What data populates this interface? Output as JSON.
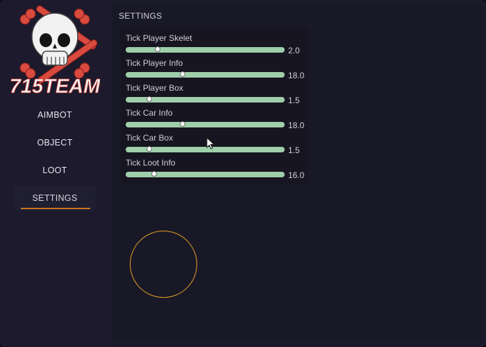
{
  "app": {
    "logo_text": "715TEAM",
    "accent_color": "#c8781e",
    "fov_circle_color": "#e3a227",
    "slider_color": "#9fceaa"
  },
  "sidebar": {
    "items": [
      {
        "label": "AIMBOT",
        "active": false
      },
      {
        "label": "OBJECT",
        "active": false
      },
      {
        "label": "LOOT",
        "active": false
      },
      {
        "label": "SETTINGS",
        "active": true
      }
    ]
  },
  "settings": {
    "title": "SETTINGS",
    "sliders": [
      {
        "label": "Tick Player Skelet",
        "value": "2.0",
        "level": 0.2
      },
      {
        "label": "Tick Player Info",
        "value": "18.0",
        "level": 0.36
      },
      {
        "label": "Tick Player Box",
        "value": "1.5",
        "level": 0.15
      },
      {
        "label": "Tick Car Info",
        "value": "18.0",
        "level": 0.36
      },
      {
        "label": "Tick Car Box",
        "value": "1.5",
        "level": 0.15
      },
      {
        "label": "Tick Loot Info",
        "value": "16.0",
        "level": 0.18
      }
    ]
  }
}
